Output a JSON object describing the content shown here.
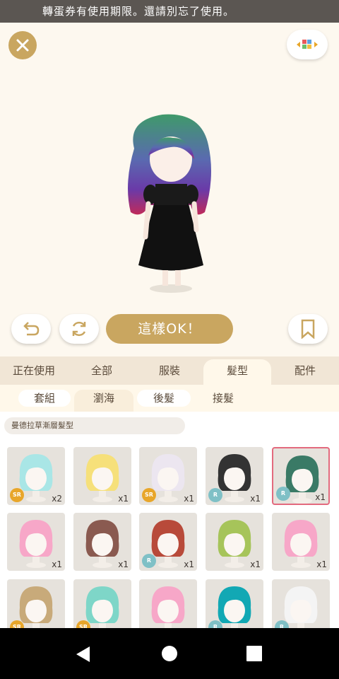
{
  "notice": "轉蛋券有使用期限。還請別忘了使用。",
  "ok_button": "這樣OK！",
  "tabs": [
    "正在使用",
    "全部",
    "服裝",
    "髮型",
    "配件"
  ],
  "active_tab": "髮型",
  "subtabs": [
    "套組",
    "瀏海",
    "後髮",
    "接髮"
  ],
  "active_subtab": "瀏海",
  "item_name": "曼德拉草漸層髮型",
  "items": [
    {
      "rarity": "SR",
      "count": "x2",
      "hair": "#a9e6e6"
    },
    {
      "rarity": "",
      "count": "x1",
      "hair": "#f6e07a"
    },
    {
      "rarity": "SR",
      "count": "x1",
      "hair": "#ece6f0"
    },
    {
      "rarity": "R",
      "count": "x1",
      "hair": "#333333"
    },
    {
      "rarity": "R",
      "count": "x1",
      "hair": "#3a7a66"
    },
    {
      "rarity": "",
      "count": "x1",
      "hair": "#f7a7c8"
    },
    {
      "rarity": "",
      "count": "x1",
      "hair": "#8a5a50"
    },
    {
      "rarity": "R",
      "count": "x1",
      "hair": "#b84a3a"
    },
    {
      "rarity": "",
      "count": "x1",
      "hair": "#a6c45a"
    },
    {
      "rarity": "",
      "count": "x1",
      "hair": "#f7a7c8"
    },
    {
      "rarity": "SR",
      "count": "",
      "hair": "#c8aa7a"
    },
    {
      "rarity": "SR",
      "count": "",
      "hair": "#7ed6c8"
    },
    {
      "rarity": "",
      "count": "",
      "hair": "#f7a7c8"
    },
    {
      "rarity": "R",
      "count": "",
      "hair": "#12a8b4"
    },
    {
      "rarity": "R",
      "count": "",
      "hair": "#f4f4f4"
    }
  ],
  "colors": {
    "accent": "#c9a660",
    "selected": "#e36a7e",
    "sr": "#e8a62a",
    "r": "#7fc0c6"
  }
}
